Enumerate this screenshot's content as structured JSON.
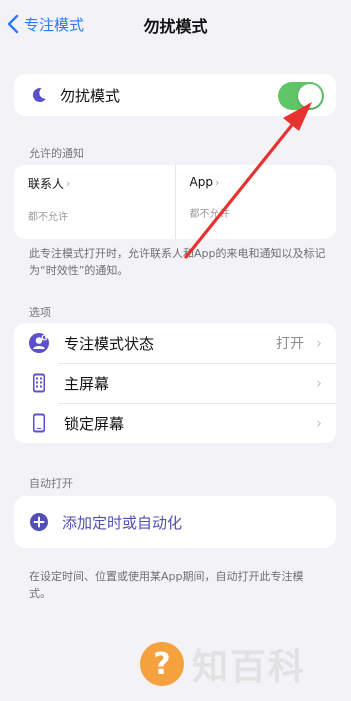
{
  "nav": {
    "back_label": "专注模式",
    "title": "勿扰模式"
  },
  "focus_row": {
    "label": "勿扰模式",
    "toggle_on": true
  },
  "allowed": {
    "header": "允许的通知",
    "people_title": "联系人",
    "people_sub": "都不允许",
    "apps_title": "App",
    "apps_sub": "都不允许"
  },
  "allowed_note": "此专注模式打开时，允许联系人和App的来电和通知以及标记为“时效性”的通知。",
  "options": {
    "header": "选项",
    "items": [
      {
        "label": "专注模式状态",
        "value": "打开",
        "icon": "focus-status-icon"
      },
      {
        "label": "主屏幕",
        "value": "",
        "icon": "home-screen-icon"
      },
      {
        "label": "锁定屏幕",
        "value": "",
        "icon": "lock-screen-icon"
      }
    ]
  },
  "auto": {
    "header": "自动打开",
    "add_label": "添加定时或自动化",
    "note": "在设定时间、位置或使用某App期间，自动打开此专注模式。"
  },
  "watermark": {
    "badge": "?",
    "text": "知百科"
  },
  "colors": {
    "accent_blue": "#2f7bf6",
    "toggle_green": "#5fc566",
    "purple": "#4f4fb5",
    "annotation_red": "#e8322f"
  }
}
